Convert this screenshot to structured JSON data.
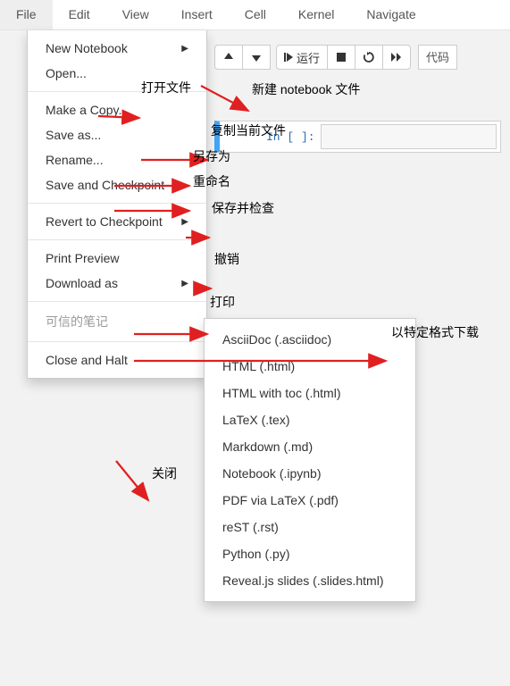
{
  "menubar": {
    "items": [
      "File",
      "Edit",
      "View",
      "Insert",
      "Cell",
      "Kernel",
      "Navigate"
    ]
  },
  "toolbar": {
    "run_label": "运行",
    "celltype": "代码"
  },
  "file_menu": {
    "new_notebook": "New Notebook",
    "open": "Open...",
    "make_copy": "Make a Copy...",
    "save_as": "Save as...",
    "rename": "Rename...",
    "save_checkpoint": "Save and Checkpoint",
    "revert": "Revert to Checkpoint",
    "print_preview": "Print Preview",
    "download_as": "Download as",
    "trusted": "可信的笔记",
    "close_halt": "Close and Halt"
  },
  "download_submenu": {
    "items": [
      "AsciiDoc (.asciidoc)",
      "HTML (.html)",
      "HTML with toc (.html)",
      "LaTeX (.tex)",
      "Markdown (.md)",
      "Notebook (.ipynb)",
      "PDF via LaTeX (.pdf)",
      "reST (.rst)",
      "Python (.py)",
      "Reveal.js slides (.slides.html)"
    ]
  },
  "cell": {
    "prompt": "In [ ]:"
  },
  "annotations": {
    "open": "打开文件",
    "new_notebook": "新建 notebook 文件",
    "make_copy": "复制当前文件",
    "save_as": "另存为",
    "rename": "重命名",
    "save_checkpoint": "保存并检查",
    "revert": "撤销",
    "print": "打印",
    "download": "以特定格式下载",
    "close": "关闭"
  }
}
